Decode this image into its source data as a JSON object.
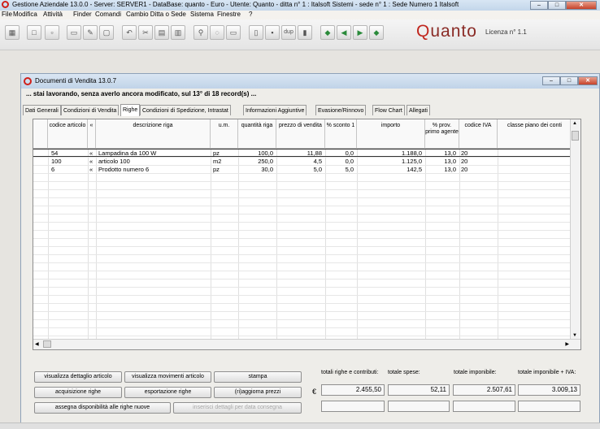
{
  "app": {
    "title": "Gestione Aziendale 13.0.0 - Server: SERVER1 - DataBase: quanto - Euro - Utente: Quanto - ditta n° 1 : Italsoft Sistemi - sede n° 1 : Sede Numero 1 Italsoft",
    "window_buttons": [
      "–",
      "□",
      "✕"
    ]
  },
  "menu": [
    "File",
    "Modifica",
    "Attività",
    "Finder",
    "Comandi",
    "Cambio Ditta o Sede",
    "Sistema",
    "Finestre",
    "?"
  ],
  "toolbar": {
    "dup_label": "dup",
    "logo_q": "Q",
    "logo_rest": "uanto",
    "licenza": "Licenza n° 1.1"
  },
  "child": {
    "title": "Documenti di Vendita 13.0.7",
    "status": "... stai lavorando, senza averlo ancora modificato, sul 13° di 18 record(s) ...",
    "tabs": [
      "Dati Generali",
      "Condizioni di Vendita",
      "Righe",
      "Condizioni di Spedizione, Intrastat",
      "Informazioni Aggiuntive",
      "Evasione/Rinnovo",
      "Flow Chart",
      "Allegati"
    ],
    "active_tab": "Righe"
  },
  "grid": {
    "headers": [
      "codice articolo",
      "«",
      "descrizione riga",
      "u.m.",
      "quantità riga",
      "prezzo di vendita",
      "% sconto 1",
      "importo",
      "% prov. primo agente",
      "codice IVA",
      "classe piano dei conti"
    ],
    "rows": [
      {
        "codice": "54",
        "arrow": "«",
        "descrizione": "Lampadina da 100 W",
        "um": "pz",
        "quantita": "100,0",
        "prezzo": "11,88",
        "sconto": "0,0",
        "importo": "1.188,0",
        "prov": "13,0",
        "iva": "20"
      },
      {
        "codice": "100",
        "arrow": "«",
        "descrizione": "articolo 100",
        "um": "m2",
        "quantita": "250,0",
        "prezzo": "4,5",
        "sconto": "0,0",
        "importo": "1.125,0",
        "prov": "13,0",
        "iva": "20"
      },
      {
        "codice": "6",
        "arrow": "«",
        "descrizione": "Prodotto numero 6",
        "um": "pz",
        "quantita": "30,0",
        "prezzo": "5,0",
        "sconto": "5,0",
        "importo": "142,5",
        "prov": "13,0",
        "iva": "20"
      }
    ]
  },
  "buttons": {
    "dettaglio": "visualizza dettaglio articolo",
    "movimenti": "visualizza movimenti articolo",
    "stampa": "stampa",
    "acquisizione": "acquisizione righe",
    "esportazione": "esportazione righe",
    "aggiorna": "(ri)aggiorna prezzi",
    "disponibilita": "assegna disponibilità alle righe nuove",
    "inserisci": "inserisci dettagli per data consegna"
  },
  "totals": {
    "labels": [
      "totali righe e contributi:",
      "totale spese:",
      "totale imponibile:",
      "totale imponibile + IVA:"
    ],
    "currency": "€",
    "values": [
      "2.455,50",
      "52,11",
      "2.507,61",
      "3.009,13"
    ]
  }
}
